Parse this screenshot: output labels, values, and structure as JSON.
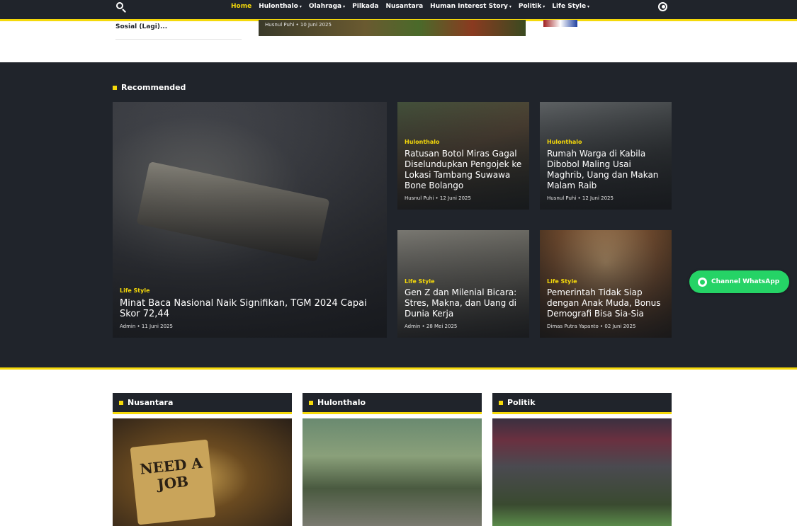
{
  "nav": {
    "items": [
      {
        "label": "Home",
        "active": true,
        "dropdown": false
      },
      {
        "label": "Hulonthalo",
        "active": false,
        "dropdown": true
      },
      {
        "label": "Olahraga",
        "active": false,
        "dropdown": true
      },
      {
        "label": "Pilkada",
        "active": false,
        "dropdown": false
      },
      {
        "label": "Nusantara",
        "active": false,
        "dropdown": false
      },
      {
        "label": "Human Interest Story",
        "active": false,
        "dropdown": true
      },
      {
        "label": "Politik",
        "active": false,
        "dropdown": true
      },
      {
        "label": "Life Style",
        "active": false,
        "dropdown": true
      }
    ],
    "caret": "▾",
    "search_icon": "search-icon",
    "globe_icon": "globe-icon"
  },
  "top_strip": {
    "left_title": "Sosial (Lagi)...",
    "mid_meta": "Husnul Puhi • 10 Juni 2025"
  },
  "recommended": {
    "title": "Recommended",
    "featured": {
      "category": "Life Style",
      "title": "Minat Baca Nasional Naik Signifikan, TGM 2024 Capai Skor 72,44",
      "meta": "Admin • 11 Juni 2025"
    },
    "cards": [
      {
        "category": "Hulonthalo",
        "title": "Ratusan Botol Miras Gagal Diselundupkan Pengojek ke Lokasi Tambang Suwawa Bone Bolango",
        "meta": "Husnul Puhi • 12 Juni 2025"
      },
      {
        "category": "Hulonthalo",
        "title": "Rumah Warga di Kabila Dibobol Maling Usai Maghrib, Uang dan Makan Malam Raib",
        "meta": "Husnul Puhi • 12 Juni 2025"
      },
      {
        "category": "Life Style",
        "title": "Gen Z dan Milenial Bicara: Stres, Makna, dan Uang di Dunia Kerja",
        "meta": "Admin • 28 Mei 2025"
      },
      {
        "category": "Life Style",
        "title": "Pemerintah Tidak Siap dengan Anak Muda, Bonus Demografi Bisa Sia-Sia",
        "meta": "Dimas Putra Yapanto • 02 Juni 2025"
      }
    ]
  },
  "whatsapp": {
    "label": "Channel WhatsApp",
    "icon": "whatsapp-icon"
  },
  "sections": [
    {
      "title": "Nusantara",
      "image_text": "NEED A JOB"
    },
    {
      "title": "Hulonthalo"
    },
    {
      "title": "Politik"
    }
  ],
  "colors": {
    "accent": "#f5d90a",
    "dark": "#20242b",
    "whatsapp": "#25d366"
  }
}
